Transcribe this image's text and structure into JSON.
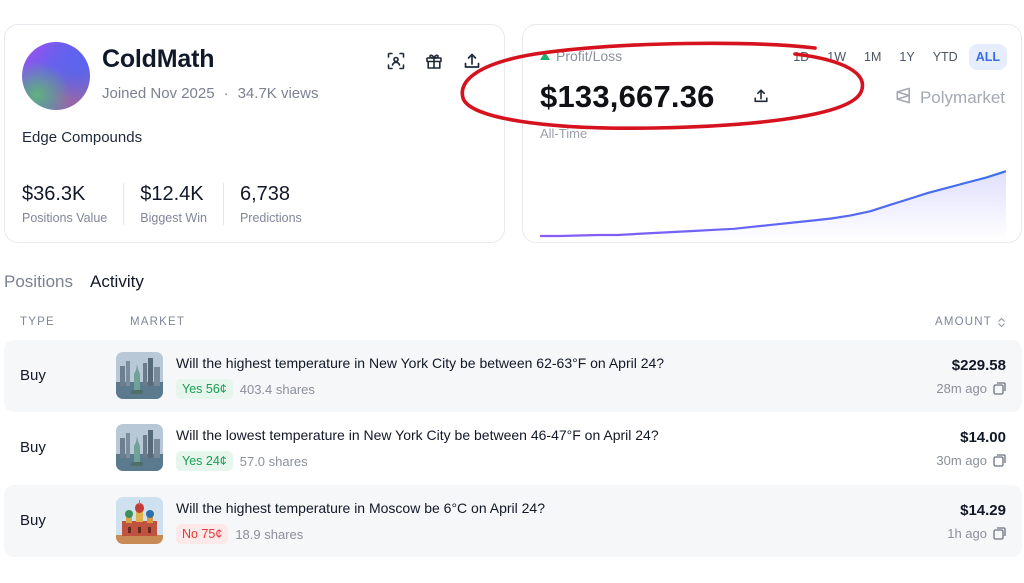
{
  "profile": {
    "username": "ColdMath",
    "joined": "Joined Nov 2025",
    "separator": "·",
    "views": "34.7K views",
    "bio": "Edge Compounds",
    "icons": [
      "scan-icon",
      "gift-icon",
      "share-icon"
    ],
    "stats": [
      {
        "value": "$36.3K",
        "label": "Positions Value"
      },
      {
        "value": "$12.4K",
        "label": "Biggest Win"
      },
      {
        "value": "6,738",
        "label": "Predictions"
      }
    ]
  },
  "pnl": {
    "label": "Profit/Loss",
    "amount": "$133,667.36",
    "period_label": "All-Time",
    "brand": "Polymarket",
    "ranges": [
      "1D",
      "1W",
      "1M",
      "1Y",
      "YTD",
      "ALL"
    ],
    "active_range": "ALL",
    "colors": {
      "line_start": "#8b5cf6",
      "line_end": "#3b6ff0",
      "positive": "#20b26c",
      "annotation": "#d6121e"
    }
  },
  "chart_data": {
    "type": "area",
    "values": [
      0,
      0,
      0.5,
      1,
      1,
      2,
      3,
      4,
      5,
      6,
      7,
      9,
      11,
      13,
      15,
      17,
      20,
      24,
      30,
      36,
      42,
      47,
      52,
      57,
      63
    ],
    "ylim": [
      0,
      70
    ]
  },
  "tabs": [
    {
      "label": "Positions",
      "active": false
    },
    {
      "label": "Activity",
      "active": true
    }
  ],
  "table": {
    "headers": {
      "type": "TYPE",
      "market": "MARKET",
      "amount": "AMOUNT"
    },
    "rows": [
      {
        "type": "Buy",
        "title": "Will the highest temperature in New York City be between 62-63°F on April 24?",
        "outcome": "Yes 56¢",
        "outcome_kind": "yes",
        "shares": "403.4 shares",
        "amount": "$229.58",
        "time": "28m ago",
        "thumb": "nyc"
      },
      {
        "type": "Buy",
        "title": "Will the lowest temperature in New York City be between 46-47°F on April 24?",
        "outcome": "Yes 24¢",
        "outcome_kind": "yes",
        "shares": "57.0 shares",
        "amount": "$14.00",
        "time": "30m ago",
        "thumb": "nyc"
      },
      {
        "type": "Buy",
        "title": "Will the highest temperature in Moscow be 6°C on April 24?",
        "outcome": "No 75¢",
        "outcome_kind": "no",
        "shares": "18.9 shares",
        "amount": "$14.29",
        "time": "1h ago",
        "thumb": "moscow"
      }
    ]
  }
}
